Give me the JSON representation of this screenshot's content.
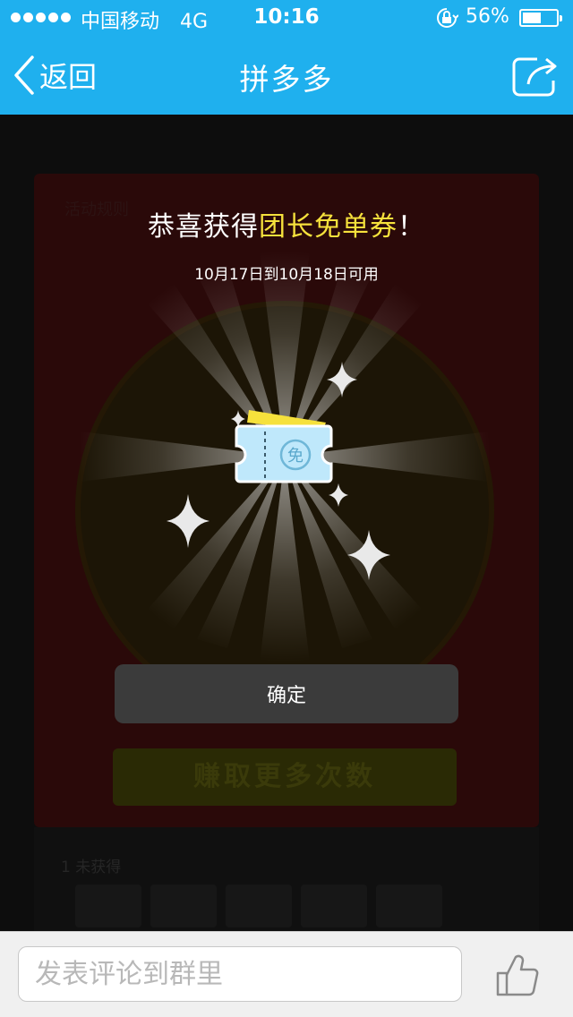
{
  "status_bar": {
    "carrier": "中国移动",
    "network": "4G",
    "time": "10:16",
    "battery": "56%",
    "battery_level": 0.56
  },
  "nav": {
    "back_label": "返回",
    "title": "拼多多",
    "share_icon": "share-icon"
  },
  "background": {
    "activity_rules": "活动规则",
    "earn_more": "赚取更多次数",
    "not_obtained": "1 未获得"
  },
  "modal": {
    "title_prefix": "恭喜获得",
    "title_highlight": "团长免单券",
    "title_suffix": "！",
    "dates": "10月17日到10月18日可用",
    "voucher_text": "免",
    "confirm": "确定"
  },
  "comment_bar": {
    "placeholder": "发表评论到群里",
    "like_icon": "thumbs-up-icon"
  },
  "colors": {
    "brand_blue": "#1fb0ee",
    "highlight_yellow": "#f6e13c",
    "voucher_blue": "#bfe8fb"
  }
}
